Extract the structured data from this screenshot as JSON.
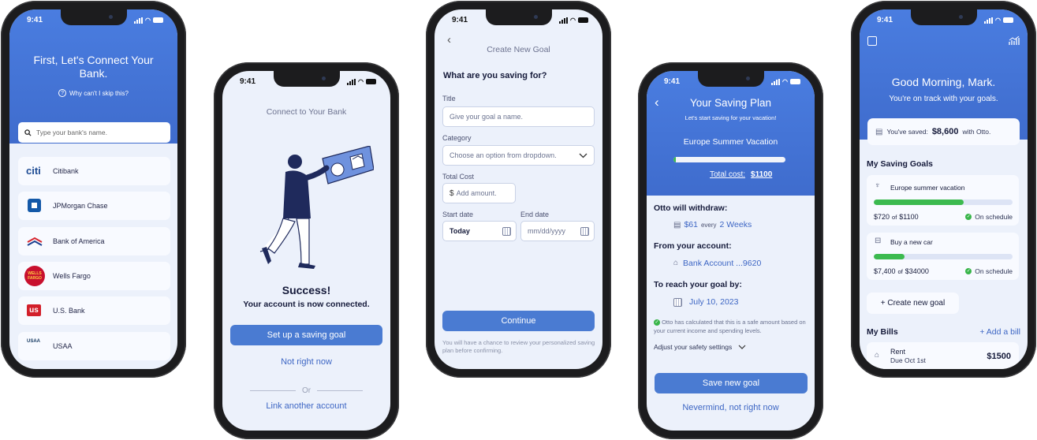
{
  "status_time": "9:41",
  "screen1": {
    "title": "First, Let's Connect Your Bank.",
    "skip_link": "Why can't I skip this?",
    "search_placeholder": "Type your bank's name.",
    "banks": [
      {
        "name": "Citibank",
        "logo_text": "citi"
      },
      {
        "name": "JPMorgan Chase",
        "logo_text": ""
      },
      {
        "name": "Bank of America",
        "logo_text": ""
      },
      {
        "name": "Wells Fargo",
        "logo_text": "WELLS FARGO"
      },
      {
        "name": "U.S. Bank",
        "logo_text": "us"
      },
      {
        "name": "USAA",
        "logo_text": "USAA"
      }
    ]
  },
  "screen2": {
    "header": "Connect to Your Bank",
    "success_title": "Success!",
    "success_sub": "Your account is now connected.",
    "primary_button": "Set up a saving goal",
    "secondary_link": "Not right now",
    "divider_text": "Or",
    "tertiary_link": "Link another account"
  },
  "screen3": {
    "header": "Create New Goal",
    "question": "What are you saving for?",
    "title_label": "Title",
    "title_placeholder": "Give your goal a name.",
    "category_label": "Category",
    "category_placeholder": "Choose an option from dropdown.",
    "cost_label": "Total Cost",
    "cost_prefix": "$",
    "cost_placeholder": "Add amount.",
    "start_label": "Start date",
    "start_value": "Today",
    "end_label": "End date",
    "end_placeholder": "mm/dd/yyyy",
    "continue_button": "Continue",
    "footnote": "You will have a chance to review your personalized saving plan before confirming."
  },
  "screen4": {
    "title": "Your Saving Plan",
    "subtitle": "Let's start saving for your vacation!",
    "goal_name": "Europe Summer Vacation",
    "total_cost_label": "Total cost:",
    "total_cost_value": "$1100",
    "progress": 0.02,
    "withdraw_label": "Otto will withdraw:",
    "withdraw_amount": "$61",
    "withdraw_every": "every",
    "withdraw_period": "2 Weeks",
    "account_label": "From your account:",
    "account_value": "Bank Account ...9620",
    "date_label": "To reach your goal by:",
    "date_value": "July 10, 2023",
    "safe_note": "Otto has calculated that this is a safe amount based on your current income and spending levels.",
    "safety_settings": "Adjust your safety settings",
    "save_button": "Save new goal",
    "cancel_link": "Nevermind, not right now"
  },
  "screen5": {
    "greeting": "Good Morning, Mark.",
    "subgreeting": "You're on track with your goals.",
    "saved_prefix": "You've saved:",
    "saved_amount": "$8,600",
    "saved_suffix": "with Otto.",
    "goals_title": "My Saving Goals",
    "goals": [
      {
        "name": "Europe summer vacation",
        "saved": "$720",
        "of": "of",
        "total": "$1100",
        "status": "On schedule",
        "progress": 0.65
      },
      {
        "name": "Buy a new car",
        "saved": "$7,400",
        "of": "of",
        "total": "$34000",
        "status": "On schedule",
        "progress": 0.22
      }
    ],
    "create_goal": "+ Create new goal",
    "bills_title": "My Bills",
    "add_bill": "+ Add a bill",
    "bill_name": "Rent",
    "bill_due": "Due Oct 1st",
    "bill_amount": "$1500"
  },
  "colors": {
    "accent": "#4a7bd2",
    "header_blue": "#4372d6",
    "success": "#39b54a",
    "progress_green": "#3cba4f"
  }
}
